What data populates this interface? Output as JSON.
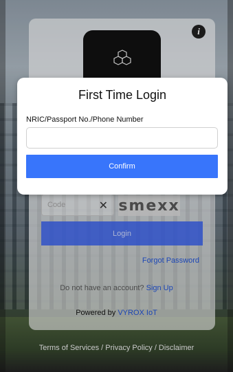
{
  "login": {
    "code_placeholder": "Code",
    "captcha_text": "smexx",
    "login_label": "Login",
    "forgot_label": "Forgot Password",
    "no_account_text": "Do not have an account?",
    "signup_label": "Sign Up",
    "powered_prefix": "Powered by",
    "powered_brand": "VYROX IoT"
  },
  "footer": {
    "text": "Terms of Services / Privacy Policy / Disclaimer"
  },
  "modal": {
    "title": "First Time Login",
    "field_label": "NRIC/Passport No./Phone Number",
    "field_value": "",
    "confirm_label": "Confirm"
  },
  "icons": {
    "info": "info-icon",
    "clear": "close-icon",
    "logo": "cube-logo-icon"
  },
  "colors": {
    "accent": "#3875fb",
    "link": "#1f4fcf"
  }
}
